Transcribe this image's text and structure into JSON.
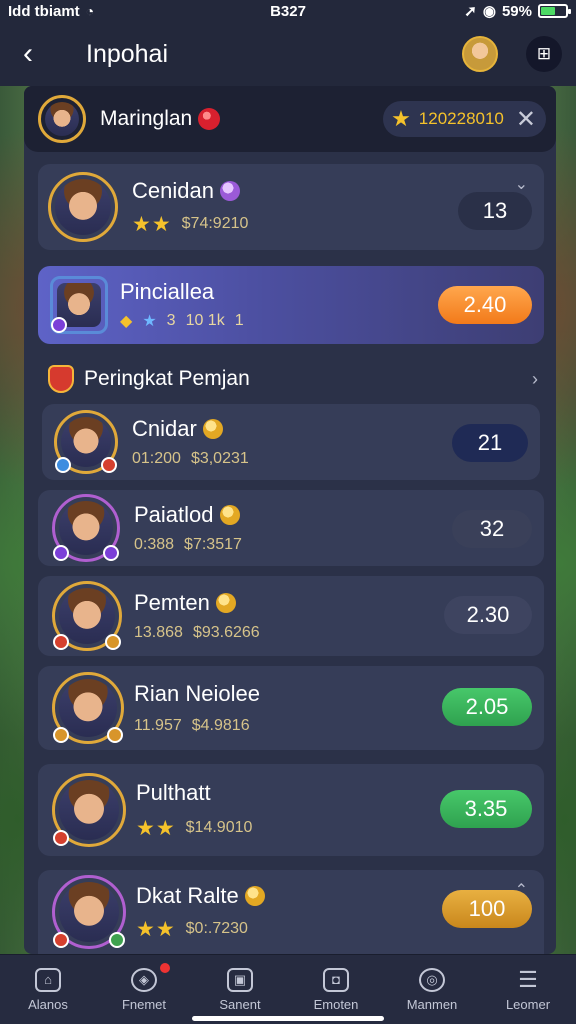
{
  "status_bar": {
    "carrier": "Idd tbiamt",
    "time": "B327",
    "battery": "59%"
  },
  "header": {
    "title": "Inpohai"
  },
  "top_bar": {
    "name": "Maringlan",
    "coins": "120228010"
  },
  "featured": {
    "name": "Cenidan",
    "stars": "★★",
    "amount": "$74:9210",
    "value": "13"
  },
  "highlight": {
    "name": "Pinciallea",
    "stat1": "3",
    "stat2": "10 1k",
    "stat3": "1",
    "value": "2.40"
  },
  "section": {
    "title": "Peringkat Pemjan"
  },
  "players": [
    {
      "name": "Cnidar",
      "line1": "01:200",
      "line2": "$3,0231",
      "value": "21"
    },
    {
      "name": "Paiatlod",
      "line1": "0:388",
      "line2": "$7:3517",
      "value": "32"
    },
    {
      "name": "Pemten",
      "line1": "13.868",
      "line2": "$93.6266",
      "value": "2.30"
    },
    {
      "name": "Rian Neiolee",
      "line1": "11.957",
      "line2": "$4.9816",
      "value": "2.05"
    },
    {
      "name": "Pulthatt",
      "line1": "★★",
      "line2": "$14.9010",
      "value": "3.35"
    },
    {
      "name": "Dkat Ralte",
      "line1": "★★",
      "line2": "$0:.7230",
      "value": "100"
    }
  ],
  "nav": [
    {
      "label": "Alanos",
      "icon": "home-icon"
    },
    {
      "label": "Fnemet",
      "icon": "shield-icon"
    },
    {
      "label": "Sanent",
      "icon": "card-icon"
    },
    {
      "label": "Emoten",
      "icon": "bag-icon"
    },
    {
      "label": "Manmen",
      "icon": "trophy-icon"
    },
    {
      "label": "Leomer",
      "icon": "menu-icon"
    }
  ]
}
